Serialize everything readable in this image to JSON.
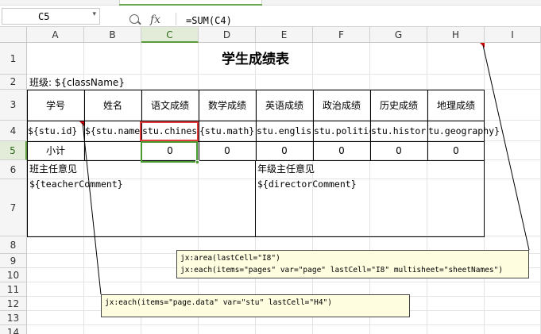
{
  "toolbar": {
    "tab_strip": ""
  },
  "formula_bar": {
    "name_box": "C5",
    "name_box_arrow": "▾",
    "fx_label": "fx",
    "formula": "=SUM(C4)"
  },
  "columns": [
    "A",
    "B",
    "C",
    "D",
    "E",
    "F",
    "G",
    "H",
    "I"
  ],
  "selected_column": "C",
  "rows": [
    "1",
    "2",
    "3",
    "4",
    "5",
    "6",
    "7",
    "8",
    "9",
    "10",
    "11",
    "12",
    "13",
    "14"
  ],
  "selected_row": "5",
  "sheet": {
    "title": "学生成绩表",
    "class_label": "班级: ${className}",
    "headers": [
      "学号",
      "姓名",
      "语文成绩",
      "数学成绩",
      "英语成绩",
      "政治成绩",
      "历史成绩",
      "地理成绩"
    ],
    "data_row": [
      "${stu.id}",
      "${stu.name",
      "stu.chines",
      "{stu.math}",
      "stu.englis",
      "stu.politic",
      "stu.histor",
      "tu.geography}"
    ],
    "subtotal_label": "小计",
    "subtotals": [
      "0",
      "0",
      "0",
      "0",
      "0",
      "0"
    ],
    "teacher_opinion_label": "班主任意见",
    "teacher_comment": "${teacherComment}",
    "director_opinion_label": "年级主任意见",
    "director_comment": "${directorComment}"
  },
  "comments": {
    "area_comment_line1": "jx:area(lastCell=\"I8\")",
    "area_comment_line2": "jx:each(items=\"pages\" var=\"page\" lastCell=\"I8\" multisheet=\"sheetNames\")",
    "each_comment": "jx:each(items=\"page.data\" var=\"stu\" lastCell=\"H4\")"
  },
  "colors": {
    "selection_green": "#4a9a32",
    "highlight_red": "#e03c3c",
    "comment_bg": "#fffde0",
    "comment_marker": "#cc0000"
  }
}
